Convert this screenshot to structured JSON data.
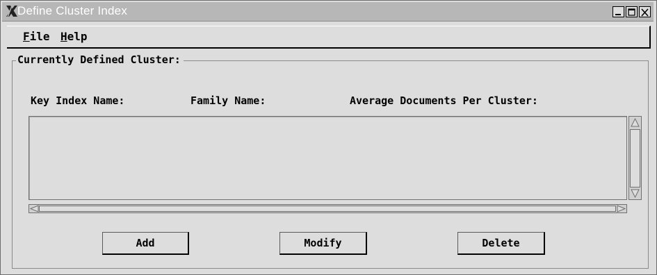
{
  "window": {
    "title": "Define Cluster Index",
    "icon": "x-logo-icon",
    "controls": [
      "minimize-icon",
      "maximize-icon",
      "close-icon"
    ]
  },
  "menu": {
    "items": [
      {
        "label": "File",
        "mnemonic": "F"
      },
      {
        "label": "Help",
        "mnemonic": "H"
      }
    ]
  },
  "group": {
    "label": "Currently Defined Cluster:"
  },
  "columns": {
    "key_index_name": "Key Index Name:",
    "family_name": "Family Name:",
    "avg_docs": "Average Documents Per Cluster:"
  },
  "list": {
    "rows": []
  },
  "buttons": {
    "add": "Add",
    "modify": "Modify",
    "delete": "Delete"
  }
}
